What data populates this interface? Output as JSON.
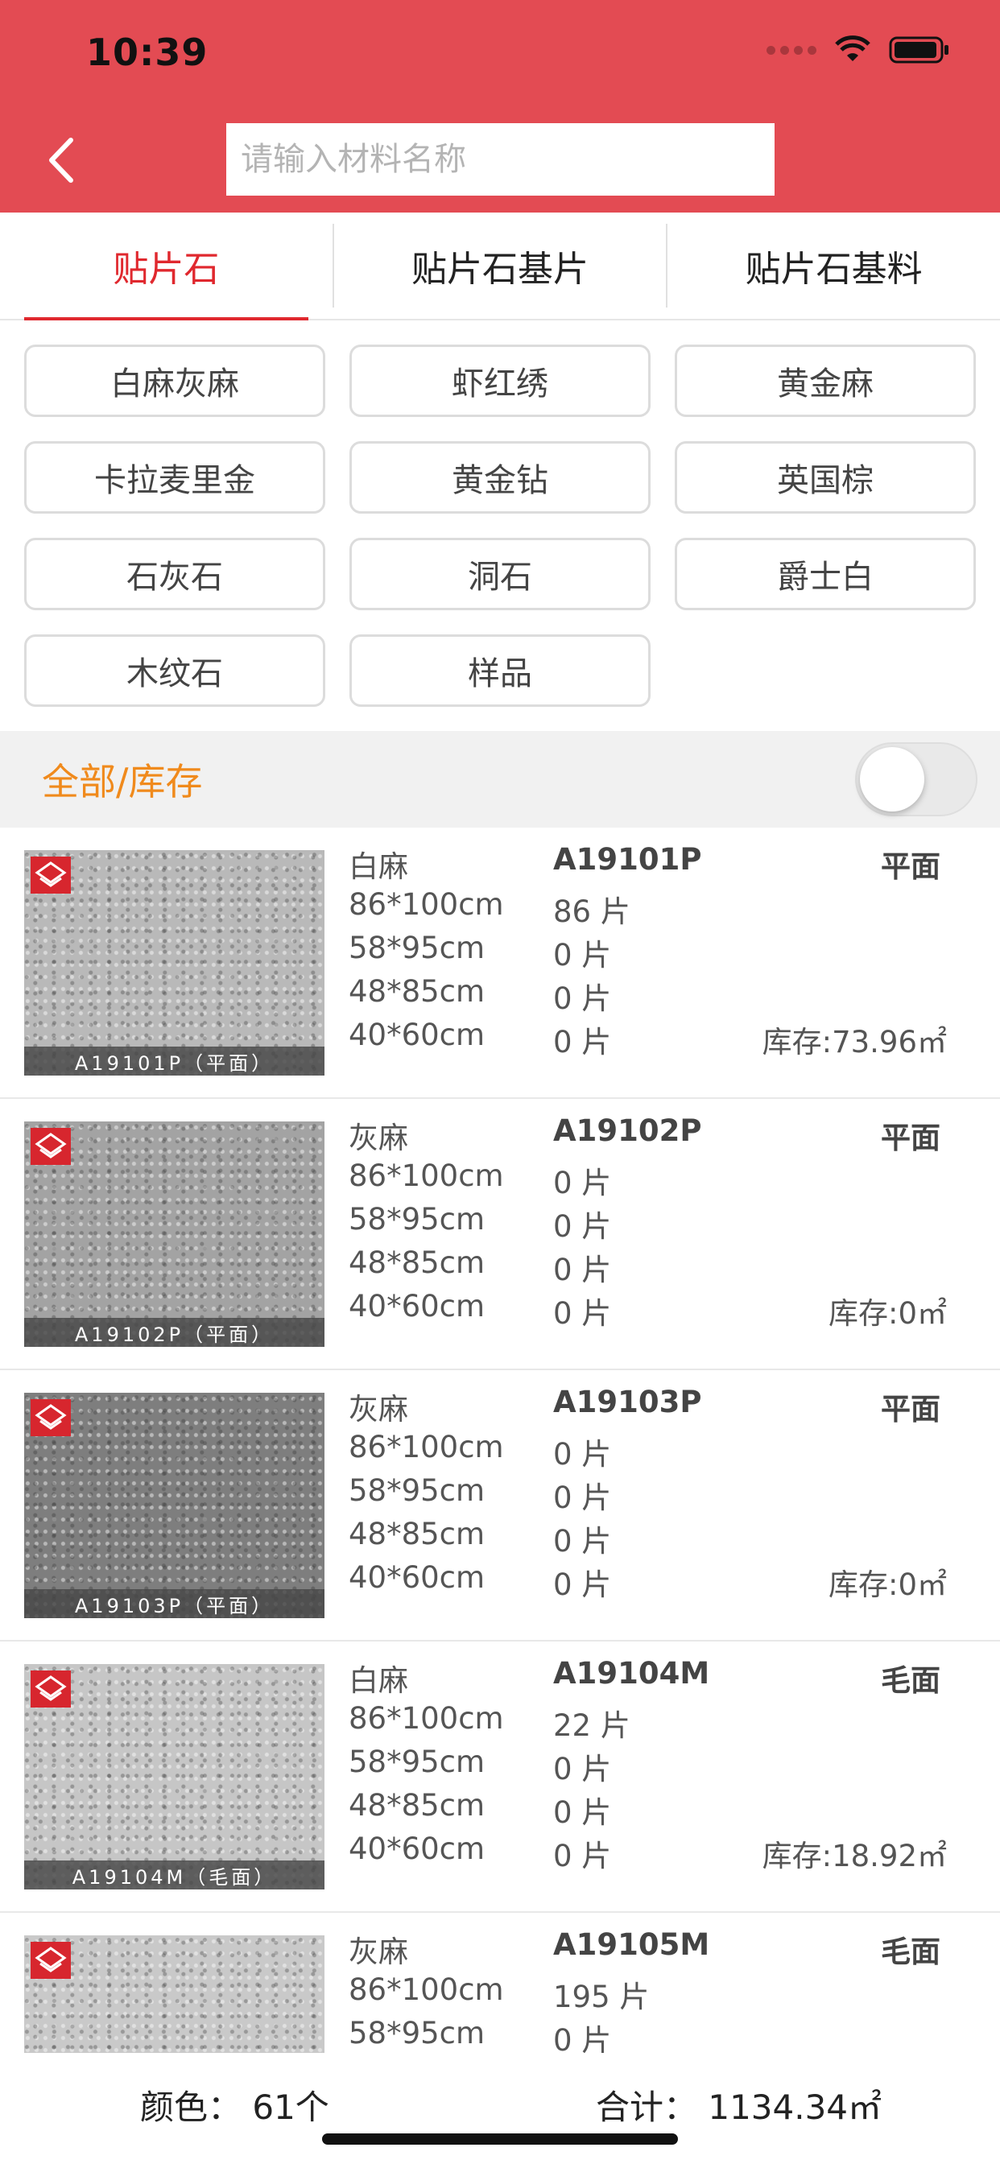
{
  "status_bar": {
    "time": "10:39"
  },
  "header": {
    "search_placeholder": "请输入材料名称"
  },
  "tabs": [
    {
      "label": "贴片石",
      "active": true
    },
    {
      "label": "贴片石基片",
      "active": false
    },
    {
      "label": "贴片石基料",
      "active": false
    }
  ],
  "categories": [
    "白麻灰麻",
    "虾红绣",
    "黄金麻",
    "卡拉麦里金",
    "黄金钻",
    "英国棕",
    "石灰石",
    "洞石",
    "爵士白",
    "木纹石",
    "样品"
  ],
  "filter": {
    "label": "全部/库存",
    "toggle_on": false
  },
  "items": [
    {
      "name": "白麻",
      "code": "A19101P",
      "finish": "平面",
      "caption": "A19101P（平面）",
      "stone_color": "#b9b9b9",
      "sizes": [
        {
          "size": "86*100cm",
          "qty": "86 片"
        },
        {
          "size": "58*95cm",
          "qty": "0 片"
        },
        {
          "size": "48*85cm",
          "qty": "0 片"
        },
        {
          "size": "40*60cm",
          "qty": "0 片"
        }
      ],
      "stock": "库存:73.96㎡"
    },
    {
      "name": "灰麻",
      "code": "A19102P",
      "finish": "平面",
      "caption": "A19102P（平面）",
      "stone_color": "#a3a3a3",
      "sizes": [
        {
          "size": "86*100cm",
          "qty": "0 片"
        },
        {
          "size": "58*95cm",
          "qty": "0 片"
        },
        {
          "size": "48*85cm",
          "qty": "0 片"
        },
        {
          "size": "40*60cm",
          "qty": "0 片"
        }
      ],
      "stock": "库存:0㎡"
    },
    {
      "name": "灰麻",
      "code": "A19103P",
      "finish": "平面",
      "caption": "A19103P（平面）",
      "stone_color": "#7e7e7e",
      "sizes": [
        {
          "size": "86*100cm",
          "qty": "0 片"
        },
        {
          "size": "58*95cm",
          "qty": "0 片"
        },
        {
          "size": "48*85cm",
          "qty": "0 片"
        },
        {
          "size": "40*60cm",
          "qty": "0 片"
        }
      ],
      "stock": "库存:0㎡"
    },
    {
      "name": "白麻",
      "code": "A19104M",
      "finish": "毛面",
      "caption": "A19104M（毛面）",
      "stone_color": "#c6c6c6",
      "sizes": [
        {
          "size": "86*100cm",
          "qty": "22 片"
        },
        {
          "size": "58*95cm",
          "qty": "0 片"
        },
        {
          "size": "48*85cm",
          "qty": "0 片"
        },
        {
          "size": "40*60cm",
          "qty": "0 片"
        }
      ],
      "stock": "库存:18.92㎡"
    },
    {
      "name": "灰麻",
      "code": "A19105M",
      "finish": "毛面",
      "caption": "",
      "stone_color": "#c9c9c9",
      "sizes": [
        {
          "size": "86*100cm",
          "qty": "195 片"
        },
        {
          "size": "58*95cm",
          "qty": "0 片"
        }
      ],
      "stock": ""
    }
  ],
  "footer": {
    "colors": "颜色：  61个",
    "total": "合计：  1134.34㎡"
  }
}
